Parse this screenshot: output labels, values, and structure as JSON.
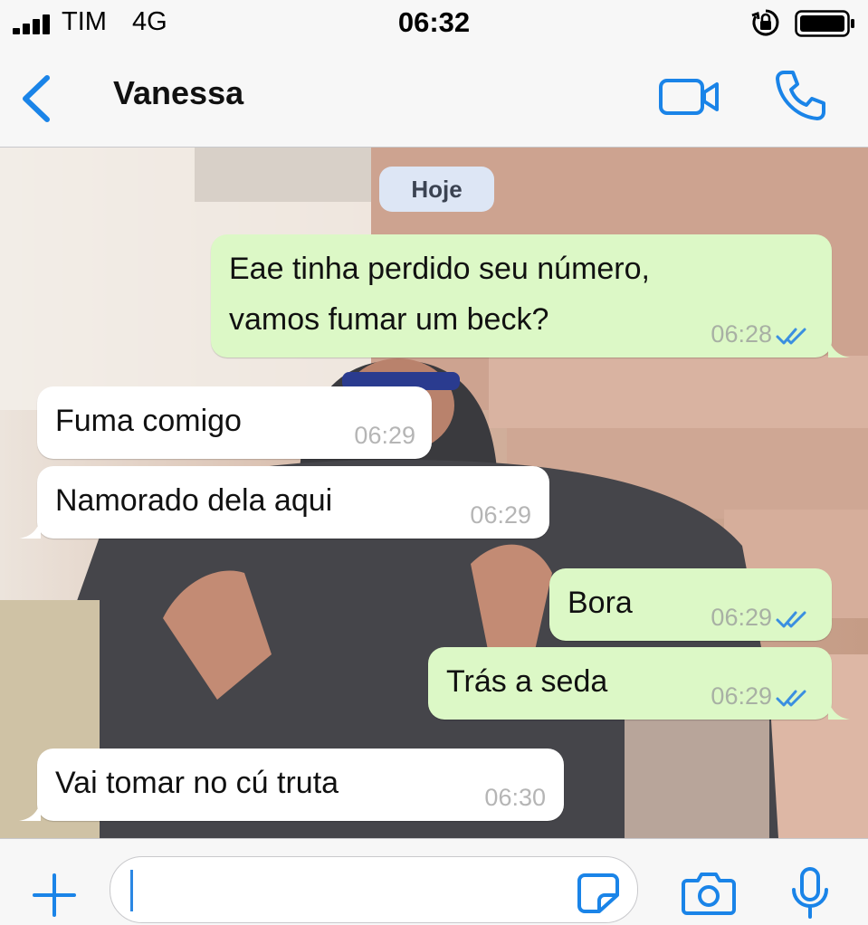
{
  "status_bar": {
    "carrier": "TIM",
    "network": "4G",
    "time": "06:32",
    "icons": [
      "signal-icon",
      "orientation-lock-icon",
      "battery-icon"
    ]
  },
  "header": {
    "back_icon": "chevron-left-icon",
    "contact_name": "Vanessa",
    "video_icon": "video-call-icon",
    "phone_icon": "phone-icon",
    "accent_color": "#1a84e8"
  },
  "chat": {
    "date_label": "Hoje",
    "messages": [
      {
        "direction": "outgoing",
        "lines": [
          "Eae tinha perdido seu número,",
          "vamos fumar um beck?"
        ],
        "time": "06:28",
        "status": "read"
      },
      {
        "direction": "incoming",
        "lines": [
          "Fuma comigo"
        ],
        "time": "06:29"
      },
      {
        "direction": "incoming",
        "lines": [
          "Namorado dela aqui"
        ],
        "time": "06:29"
      },
      {
        "direction": "outgoing",
        "lines": [
          "Bora"
        ],
        "time": "06:29",
        "status": "read"
      },
      {
        "direction": "outgoing",
        "lines": [
          "Trás a seda"
        ],
        "time": "06:29",
        "status": "read"
      },
      {
        "direction": "incoming",
        "lines": [
          "Vai tomar no cú truta"
        ],
        "time": "06:30"
      }
    ],
    "outgoing_bubble_color": "#dcf8c6",
    "incoming_bubble_color": "#ffffff",
    "read_tick_color": "#3a8fe0"
  },
  "input_bar": {
    "message_value": "",
    "icons": [
      "plus-icon",
      "sticker-icon",
      "camera-icon",
      "microphone-icon"
    ]
  }
}
